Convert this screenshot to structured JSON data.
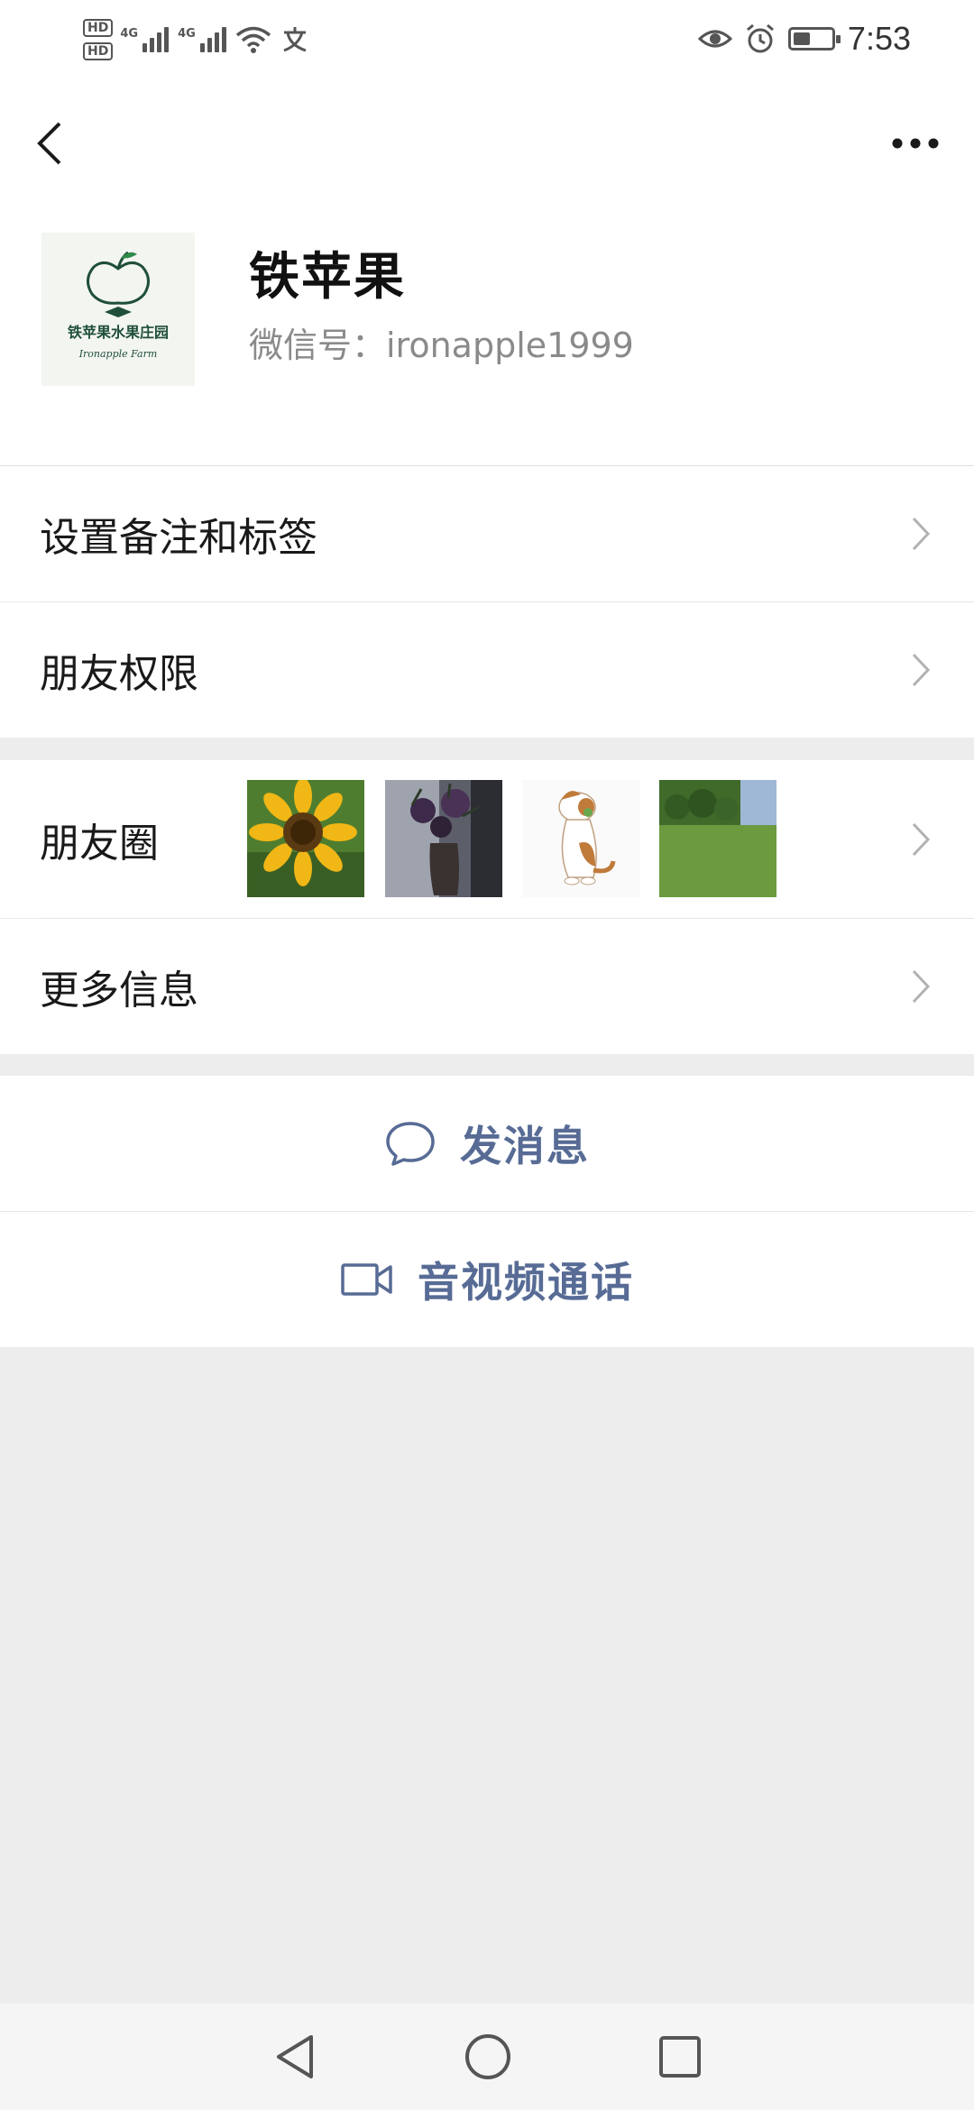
{
  "status_bar": {
    "hd1": "HD",
    "hd2": "HD",
    "net1": "4G",
    "net2": "4G",
    "time": "7:53",
    "icons": [
      "wifi-icon",
      "alipay-icon",
      "eye-icon",
      "alarm-icon",
      "battery-icon"
    ],
    "battery_level": 0.45
  },
  "header": {
    "back_icon": "chevron-left-icon",
    "more_icon": "more-dots-icon"
  },
  "profile": {
    "name": "铁苹果",
    "wechat_id": "微信号：ironapple1999",
    "avatar_text": "铁苹果水果庄园",
    "avatar_subtext": "Ironapple Farm"
  },
  "settings": {
    "remark_tags_label": "设置备注和标签",
    "friend_permissions_label": "朋友权限"
  },
  "moments": {
    "label": "朋友圈",
    "thumbnails": [
      "sunflower",
      "flowers-in-vase",
      "cartoon-cat",
      "green-field"
    ]
  },
  "more_info": {
    "label": "更多信息"
  },
  "actions": {
    "send_message_label": "发消息",
    "video_call_label": "音视频通话"
  },
  "colors": {
    "accent": "#576b95",
    "background": "#ededed",
    "card": "#ffffff",
    "text": "#191919",
    "secondary_text": "#8a8a8a"
  }
}
